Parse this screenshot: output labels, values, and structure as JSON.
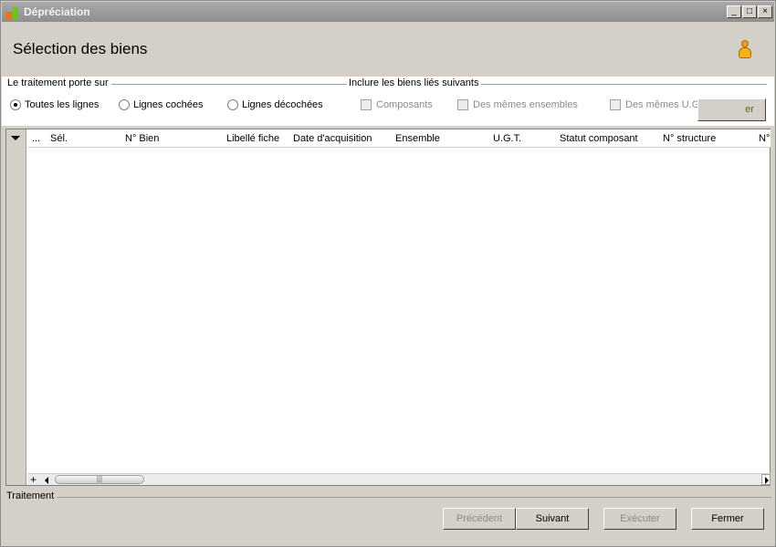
{
  "window": {
    "title": "Dépréciation",
    "minimize_glyph": "_",
    "maximize_glyph": "□",
    "close_glyph": "×"
  },
  "header": {
    "title": "Sélection des biens",
    "user_icon": "person-icon"
  },
  "scope": {
    "label": "Le traitement porte sur",
    "options": [
      "Toutes les lignes",
      "Lignes cochées",
      "Lignes décochées"
    ],
    "selected": "Toutes les lignes"
  },
  "linked": {
    "label": "Inclure les biens liés suivants",
    "options": [
      "Composants",
      "Des mêmes ensembles",
      "Des mêmes U.G.T."
    ],
    "partial_button": "er"
  },
  "grid": {
    "columns": [
      "...",
      "Sél.",
      "N° Bien",
      "Libellé fiche",
      "Date d'acquisition",
      "Ensemble",
      "U.G.T.",
      "Statut composant",
      "N° structure",
      "N°"
    ],
    "rows": [],
    "scroll_plus": "+",
    "thumb_grip": "|||"
  },
  "footer": {
    "group_label": "Traitement",
    "buttons": {
      "previous": "Précédent",
      "next": "Suivant",
      "execute": "Exécuter",
      "close": "Fermer"
    }
  }
}
